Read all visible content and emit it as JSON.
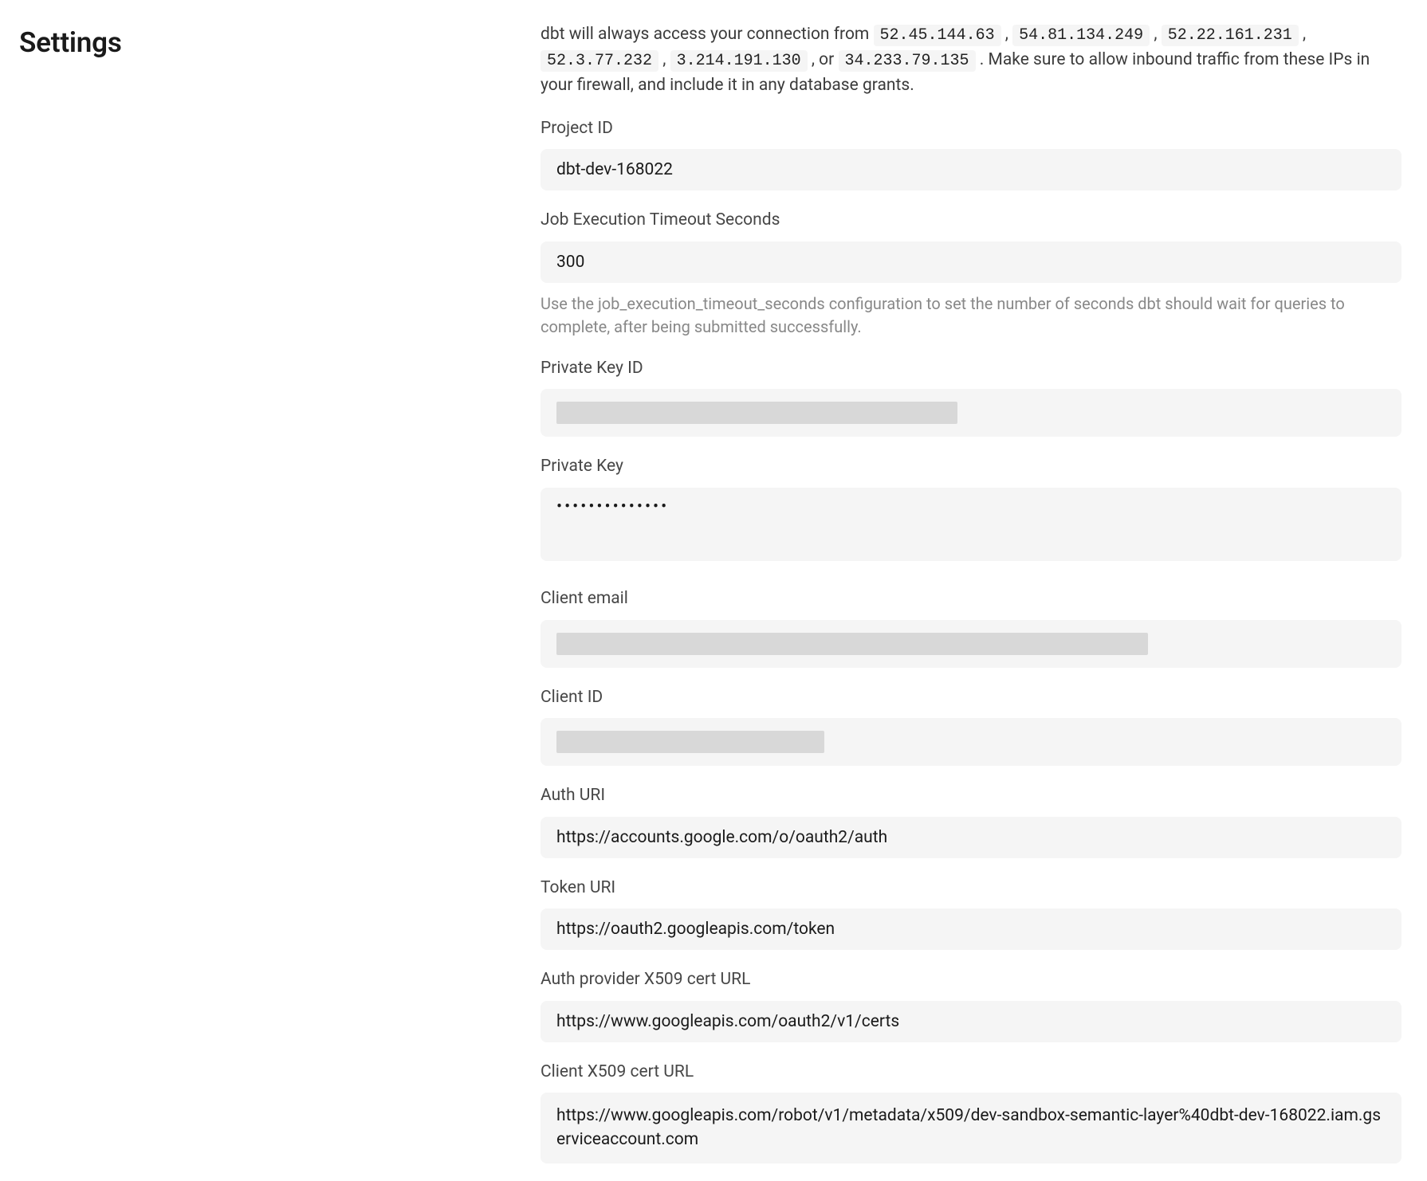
{
  "title": "Settings",
  "intro": {
    "prefix": "dbt will always access your connection from ",
    "ip1": "52.45.144.63",
    "sep1": ", ",
    "ip2": "54.81.134.249",
    "sep2": ", ",
    "ip3": "52.22.161.231",
    "sep3": ", ",
    "ip4": "52.3.77.232",
    "sep4": ", ",
    "ip5": "3.214.191.130",
    "sep5": ", or ",
    "ip6": "34.233.79.135",
    "suffix": ". Make sure to allow inbound traffic from these IPs in your firewall, and include it in any database grants."
  },
  "fields": {
    "project_id": {
      "label": "Project ID",
      "value": "dbt-dev-168022"
    },
    "job_timeout": {
      "label": "Job Execution Timeout Seconds",
      "value": "300",
      "help": "Use the job_execution_timeout_seconds configuration to set the number of seconds dbt should wait for queries to complete, after being submitted successfully."
    },
    "private_key_id": {
      "label": "Private Key ID"
    },
    "private_key": {
      "label": "Private Key",
      "value": "••••••••••••••"
    },
    "client_email": {
      "label": "Client email"
    },
    "client_id": {
      "label": "Client ID"
    },
    "auth_uri": {
      "label": "Auth URI",
      "value": "https://accounts.google.com/o/oauth2/auth"
    },
    "token_uri": {
      "label": "Token URI",
      "value": "https://oauth2.googleapis.com/token"
    },
    "auth_provider_cert": {
      "label": "Auth provider X509 cert URL",
      "value": "https://www.googleapis.com/oauth2/v1/certs"
    },
    "client_cert": {
      "label": "Client X509 cert URL",
      "value": "https://www.googleapis.com/robot/v1/metadata/x509/dev-sandbox-semantic-layer%40dbt-dev-168022.iam.gserviceaccount.com"
    }
  }
}
